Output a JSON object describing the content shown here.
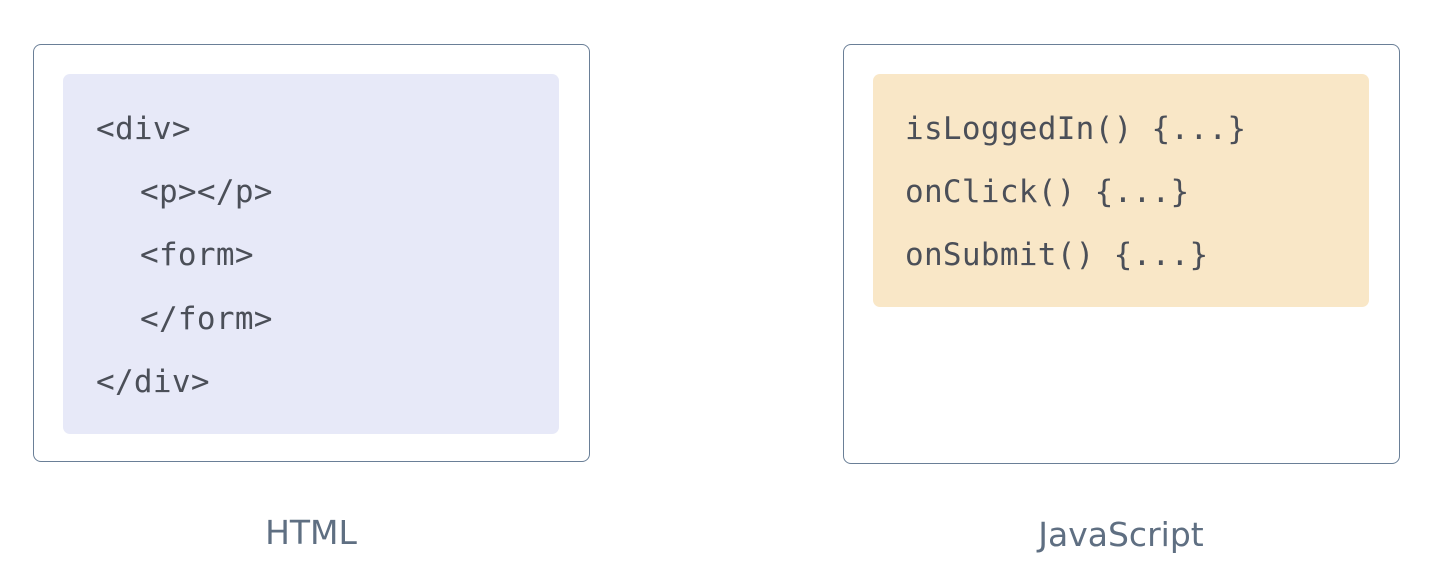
{
  "html_panel": {
    "caption": "HTML",
    "lines": [
      "<div>",
      "<p></p>",
      "<form>",
      "</form>",
      "</div>"
    ]
  },
  "js_panel": {
    "caption": "JavaScript",
    "lines": [
      "isLoggedIn() {...}",
      "onClick() {...}",
      "onSubmit() {...}"
    ]
  },
  "colors": {
    "html_code_bg": "#e7e9f8",
    "js_code_bg": "#f9e7c7",
    "panel_border": "#6a7f97",
    "code_text": "#4b4f58",
    "caption_text": "#5f6f82"
  }
}
